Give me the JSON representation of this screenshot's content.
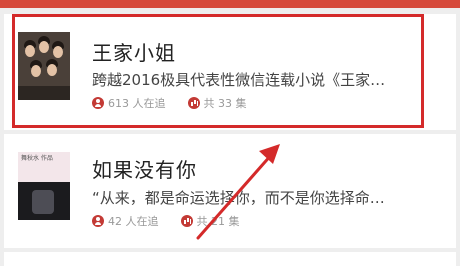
{
  "books": [
    {
      "title": "王家小姐",
      "description": "跨越2016极具代表性微信连载小说《王家…",
      "readers": "613 人在追",
      "episodes": "共 33 集"
    },
    {
      "title": "如果没有你",
      "description": "“从来，都是命运选择你，而不是你选择命…",
      "readers": "42 人在追",
      "episodes": "共 21 集",
      "cover_text": "舞秋水 作品"
    }
  ],
  "colors": {
    "top_bar": "#d64a3b",
    "highlight": "#d42a2a",
    "icon": "#c33a35",
    "arrow": "#d42a2a"
  }
}
